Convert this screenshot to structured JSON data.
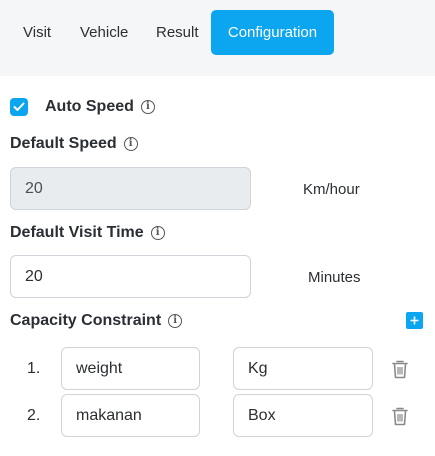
{
  "tabs": [
    {
      "label": "Visit",
      "active": false
    },
    {
      "label": "Vehicle",
      "active": false
    },
    {
      "label": "Result",
      "active": false
    },
    {
      "label": "Configuration",
      "active": true
    }
  ],
  "auto_speed": {
    "label": "Auto Speed",
    "checked": true
  },
  "default_speed": {
    "label": "Default Speed",
    "value": "20",
    "unit": "Km/hour",
    "disabled": true
  },
  "default_visit_time": {
    "label": "Default Visit Time",
    "value": "20",
    "unit": "Minutes"
  },
  "capacity_constraint": {
    "label": "Capacity Constraint",
    "items": [
      {
        "number": "1.",
        "name": "weight",
        "unit": "Kg"
      },
      {
        "number": "2.",
        "name": "makanan",
        "unit": "Box"
      }
    ]
  },
  "colors": {
    "accent": "#0ba5f0",
    "disabled_bg": "#e9ecef"
  },
  "icons": {
    "info": "info-icon",
    "add": "plus-icon",
    "delete": "trash-icon",
    "check": "checkmark-icon"
  }
}
